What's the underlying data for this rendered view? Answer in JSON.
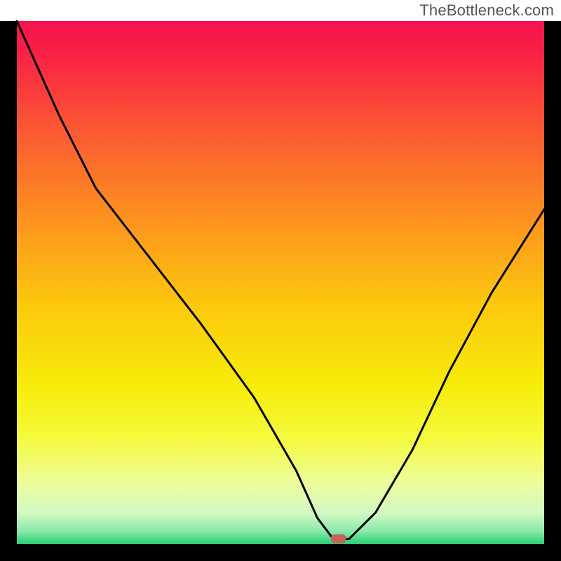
{
  "attribution": "TheBottleneck.com",
  "chart_data": {
    "type": "line",
    "title": "",
    "xlabel": "",
    "ylabel": "",
    "xlim": [
      0,
      100
    ],
    "ylim": [
      0,
      100
    ],
    "x": [
      0,
      8,
      15,
      25,
      35,
      45,
      53,
      57,
      60,
      63,
      68,
      75,
      82,
      90,
      100
    ],
    "values": [
      100,
      82,
      68,
      55,
      42,
      28,
      14,
      5,
      1,
      1,
      6,
      18,
      33,
      48,
      64
    ],
    "minimum_marker": {
      "x": 61,
      "y": 1
    },
    "gradient_stops": [
      {
        "offset": 0,
        "color": "#f5134e"
      },
      {
        "offset": 0.05,
        "color": "#f71e47"
      },
      {
        "offset": 0.2,
        "color": "#fb5533"
      },
      {
        "offset": 0.4,
        "color": "#fd9a1d"
      },
      {
        "offset": 0.55,
        "color": "#fcca0c"
      },
      {
        "offset": 0.7,
        "color": "#f7ed0a"
      },
      {
        "offset": 0.8,
        "color": "#f5fb41"
      },
      {
        "offset": 0.88,
        "color": "#eefd9a"
      },
      {
        "offset": 0.94,
        "color": "#d2f9c2"
      },
      {
        "offset": 0.975,
        "color": "#8be9ab"
      },
      {
        "offset": 1.0,
        "color": "#26cf73"
      }
    ],
    "marker_color": "#c56559",
    "frame_color": "#000000",
    "line_color": "#000000"
  }
}
